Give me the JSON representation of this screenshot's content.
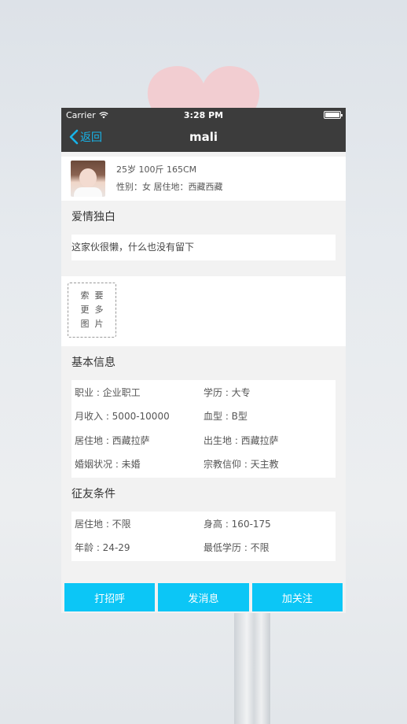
{
  "status_bar": {
    "carrier": "Carrier",
    "time": "3:28 PM"
  },
  "nav": {
    "back_label": "返回",
    "title": "mali"
  },
  "profile": {
    "line1": "25岁  100斤  165CM",
    "line2": "性别：女  居住地：西藏西藏"
  },
  "monologue": {
    "title": "爱情独白",
    "text": "这家伙很懒，什么也没有留下"
  },
  "photos": {
    "more_label": "索要\n更多\n图片"
  },
  "basic_info": {
    "title": "基本信息",
    "rows": [
      [
        "职业 : 企业职工",
        "学历 : 大专"
      ],
      [
        "月收入 : 5000-10000",
        "血型 : B型"
      ],
      [
        "居住地 : 西藏拉萨",
        "出生地 : 西藏拉萨"
      ],
      [
        "婚姻状况 : 未婚",
        "宗教信仰 : 天主教"
      ]
    ]
  },
  "criteria": {
    "title": "征友条件",
    "rows": [
      [
        "居住地 : 不限",
        "身高 : 160-175"
      ],
      [
        "年龄 : 24-29",
        "最低学历 : 不限"
      ]
    ]
  },
  "actions": {
    "greet": "打招呼",
    "message": "发消息",
    "follow": "加关注"
  },
  "colors": {
    "accent": "#0cc6f6",
    "back_link": "#17b3e8",
    "nav_bg": "#3c3c3c",
    "page_bg": "#f2f2f2"
  },
  "icons": {
    "wifi": "wifi-icon",
    "battery": "battery-icon",
    "back": "chevron-left-icon"
  }
}
